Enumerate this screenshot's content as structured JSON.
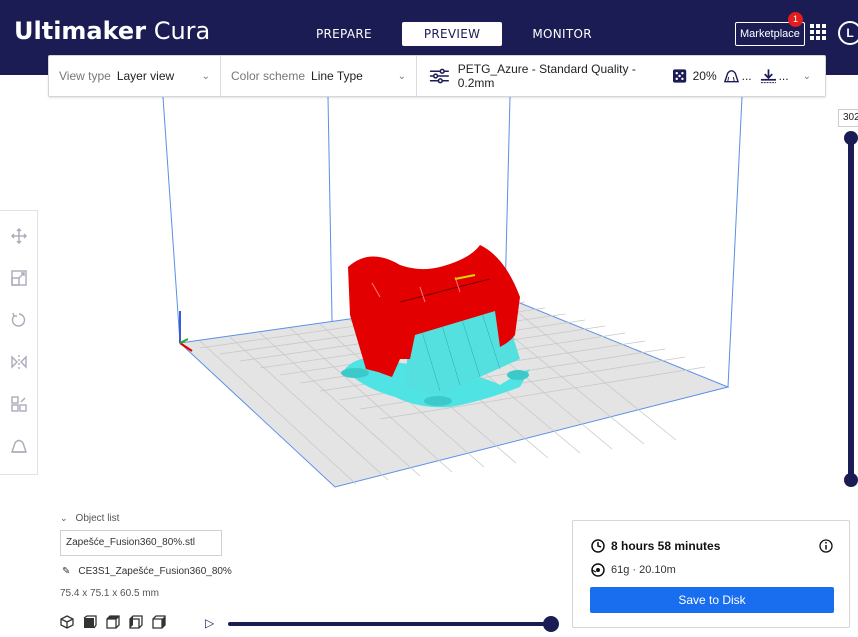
{
  "app": {
    "brand_bold": "Ultimaker",
    "brand_light": "Cura"
  },
  "stages": [
    "PREPARE",
    "PREVIEW",
    "MONITOR"
  ],
  "active_stage": "PREVIEW",
  "header": {
    "marketplace_label": "Marketplace",
    "marketplace_badge": "1",
    "account_initial": "L"
  },
  "toolbar": {
    "view_type_label": "View type",
    "view_type_value": "Layer view",
    "color_scheme_label": "Color scheme",
    "color_scheme_value": "Line Type",
    "profile": "PETG_Azure - Standard Quality - 0.2mm",
    "infill": "20%",
    "support_value": "...",
    "adhesion_value": "..."
  },
  "layer_slider": {
    "top_value": "302"
  },
  "object_list": {
    "header": "Object list",
    "file_name": "Zapešće_Fusion360_80%.stl",
    "job_name": "CE3S1_Zapešće_Fusion360_80%",
    "dimensions": "75.4 x 75.1 x 60.5 mm"
  },
  "output": {
    "print_time": "8 hours 58 minutes",
    "material": "61g · 20.10m",
    "save_label": "Save to Disk"
  },
  "colors": {
    "header_bg": "#1c1c54",
    "accent_blue": "#196ef0",
    "model_red": "#e30000",
    "support_cyan": "#4fe3e3"
  }
}
